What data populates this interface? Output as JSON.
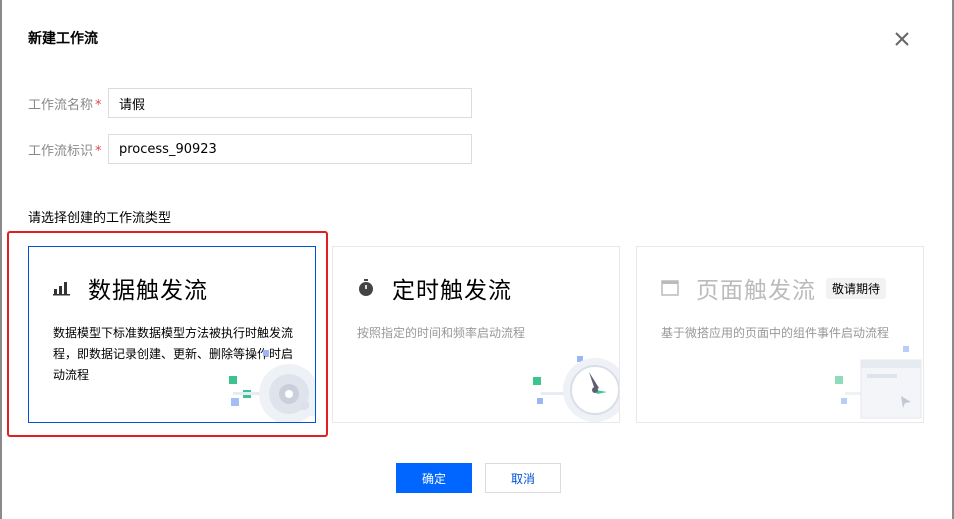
{
  "dialog": {
    "title": "新建工作流",
    "close_icon": "close-icon"
  },
  "form": {
    "name": {
      "label": "工作流名称",
      "required_mark": "*",
      "value": "请假"
    },
    "identifier": {
      "label": "工作流标识",
      "required_mark": "*",
      "value": "process_90923"
    }
  },
  "section": {
    "title": "请选择创建的工作流类型"
  },
  "cards": [
    {
      "icon": "bar-chart-icon",
      "title": "数据触发流",
      "desc": "数据模型下标准数据模型方法被执行时触发流程，即数据记录创建、更新、删除等操作时启动流程",
      "selected": true
    },
    {
      "icon": "stopwatch-icon",
      "title": "定时触发流",
      "desc": "按照指定的时间和频率启动流程",
      "selected": false
    },
    {
      "icon": "window-icon",
      "title": "页面触发流",
      "badge": "敬请期待",
      "desc": "基于微搭应用的页面中的组件事件启动流程",
      "selected": false,
      "disabled": true
    }
  ],
  "footer": {
    "confirm_label": "确定",
    "cancel_label": "取消"
  },
  "colors": {
    "primary": "#0066ff",
    "selected_border": "#0052d9",
    "highlight": "#e02020",
    "required": "#e54545"
  }
}
